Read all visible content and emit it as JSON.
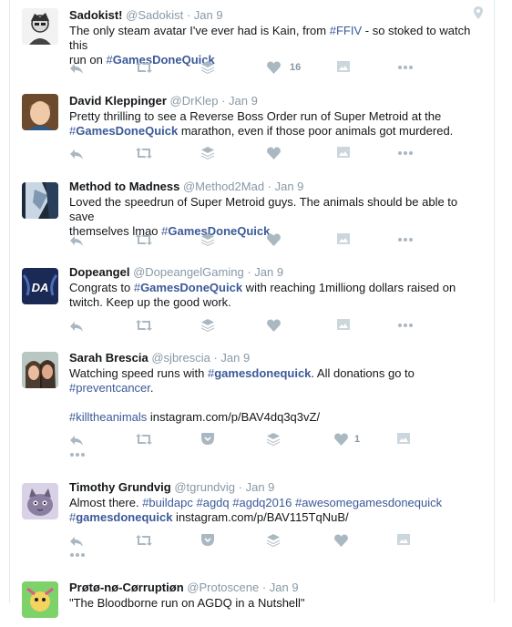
{
  "tweets": [
    {
      "name": "Sadokist!",
      "handle": "@Sadokist",
      "date": "Jan 9",
      "lines": [
        [
          {
            "t": "The only steam avatar I've ever had is Kain, from "
          },
          {
            "t": "#FFIV",
            "h": true
          },
          {
            "t": " - so stoked to watch this"
          }
        ],
        [
          {
            "t": "run on "
          },
          {
            "t": "#",
            "h": true
          },
          {
            "t": "GamesDoneQuick",
            "h": true,
            "b": true
          }
        ]
      ],
      "like_count": "16"
    },
    {
      "name": "David Kleppinger",
      "handle": "@DrKlep",
      "date": "Jan 9",
      "lines": [
        [
          {
            "t": "Pretty thrilling to see a Reverse Boss Order run of Super Metroid at the"
          }
        ],
        [
          {
            "t": "#",
            "h": true
          },
          {
            "t": "GamesDoneQuick",
            "h": true,
            "b": true
          },
          {
            "t": " marathon, even if those poor animals got murdered."
          }
        ]
      ]
    },
    {
      "name": "Method to Madness",
      "handle": "@Method2Mad",
      "date": "Jan 9",
      "lines": [
        [
          {
            "t": "Loved the speedrun of Super Metroid guys. The animals should be able to save"
          }
        ],
        [
          {
            "t": "themselves lmao "
          },
          {
            "t": "#",
            "h": true
          },
          {
            "t": "GamesDoneQuick",
            "h": true,
            "b": true
          }
        ]
      ]
    },
    {
      "name": "Dopeangel",
      "handle": "@DopeangelGaming",
      "date": "Jan 9",
      "lines": [
        [
          {
            "t": "Congrats to "
          },
          {
            "t": "#",
            "h": true
          },
          {
            "t": "GamesDoneQuick",
            "h": true,
            "b": true
          },
          {
            "t": " with reaching 1milliong dollars raised on"
          }
        ],
        [
          {
            "t": "twitch. Keep up the good work."
          }
        ]
      ]
    },
    {
      "name": "Sarah Brescia",
      "handle": "@sjbrescia",
      "date": "Jan 9",
      "lines": [
        [
          {
            "t": "Watching speed runs with "
          },
          {
            "t": "#",
            "h": true
          },
          {
            "t": "gamesdonequick",
            "h": true,
            "b": true
          },
          {
            "t": ". All donations go to"
          }
        ],
        [
          {
            "t": "#preventcancer",
            "h": true
          },
          {
            "t": "."
          }
        ],
        [],
        [
          {
            "t": "#killtheanimals",
            "h": true
          },
          {
            "t": " instagram.com/p/BAV4dq3q3vZ/"
          }
        ]
      ],
      "like_count": "1"
    },
    {
      "name": "Timothy Grundvig",
      "handle": "@tgrundvig",
      "date": "Jan 9",
      "lines": [
        [
          {
            "t": "Almost there. "
          },
          {
            "t": "#buildapc",
            "h": true
          },
          {
            "t": " "
          },
          {
            "t": "#agdq",
            "h": true
          },
          {
            "t": " "
          },
          {
            "t": "#agdq2016",
            "h": true
          },
          {
            "t": " "
          },
          {
            "t": "#awesomegamesdonequick",
            "h": true
          }
        ],
        [
          {
            "t": "#",
            "h": true
          },
          {
            "t": "gamesdonequick",
            "h": true,
            "b": true
          },
          {
            "t": " instagram.com/p/BAV115TqNuB/"
          }
        ]
      ]
    },
    {
      "name": "Prøtø-nø-Cørruptiøn",
      "handle": "@Protoscene",
      "date": "Jan 9",
      "lines": [
        [
          {
            "t": "\"The Bloodborne run on AGDQ in a Nutshell\""
          }
        ]
      ]
    }
  ],
  "icons": {
    "reply": "reply-icon",
    "retweet": "retweet-icon",
    "buffer": "buffer-stack-icon",
    "pocket": "pocket-save-icon",
    "like": "heart-icon",
    "media": "image-icon",
    "more": "more-dots-icon",
    "location": "location-pin-icon"
  },
  "colors": {
    "hashtag": "#3b5998",
    "muted": "#8899a6",
    "icon": "#aab8c2",
    "border": "#e1e8ed"
  }
}
